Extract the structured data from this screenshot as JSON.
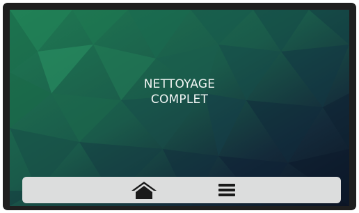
{
  "screen": {
    "message_lines": [
      "NETTOYAGE",
      "COMPLET"
    ]
  },
  "navbar": {
    "buttons": [
      {
        "icon": "home-icon",
        "color": "#1a1a1a"
      },
      {
        "icon": "menu-icon",
        "color": "#1a1a1a"
      }
    ]
  },
  "colors": {
    "bezel": "#1f1f1f",
    "background_green": "#1f7a50",
    "background_dark": "#0d1a2a",
    "text": "#f2f6f4",
    "navbar": "#dcdddd"
  }
}
